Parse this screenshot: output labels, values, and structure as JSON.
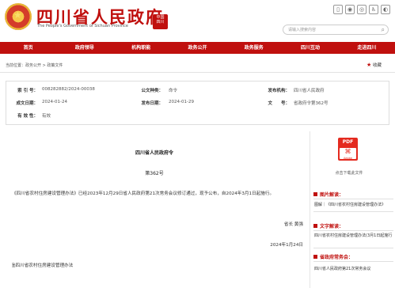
{
  "header": {
    "site_title": "四川省人民政府",
    "site_subtitle": "The People's Government of Sichuan Province",
    "search_placeholder": "请输入搜索内容",
    "top_icons": [
      "mobile-icon",
      "weibo-icon",
      "wechat-icon",
      "accessibility-icon",
      "elder-mode-icon"
    ]
  },
  "nav": {
    "items": [
      "首页",
      "政府领导",
      "机构职能",
      "政务公开",
      "政务服务",
      "四川互动",
      "走进四川"
    ]
  },
  "breadcrumb": {
    "label": "当前位置：",
    "path": [
      "政务公开",
      "政策文件"
    ],
    "separator": " > "
  },
  "favorite": {
    "label": "收藏"
  },
  "info": {
    "index_label": "索 引 号：",
    "index_value": "008282882/2024-00038",
    "category_label": "公文种类：",
    "category_value": "命令",
    "issuer_label": "发布机构：",
    "issuer_value": "四川省人民政府",
    "created_label": "成文日期：",
    "created_value": "2024-01-24",
    "published_label": "发布日期：",
    "published_value": "2024-01-29",
    "docno_label": "文　　号：",
    "docno_value": "省政府令第362号",
    "validity_label": "有 效 性：",
    "validity_value": "有效"
  },
  "article": {
    "title": "四川省人民政府令",
    "number": "第362号",
    "body": "《四川省农村住房建设管理办法》已经2023年12月29日省人民政府第21次常务会议修订通过，现予公布，自2024年3月1日起施行。",
    "signer": "省长  黄强",
    "date": "2024年1月24日",
    "attachment": "四川省农村住房建设管理办法"
  },
  "sidebar": {
    "pdf_label": "点击下载此文件",
    "pdf_badge": "PDF",
    "pdf_brand": "Adobe",
    "sections": [
      {
        "title": "图片解读：",
        "links": [
          "图解｜《四川省农村住房建设管理办法》"
        ]
      },
      {
        "title": "文字解读：",
        "links": [
          "四川省农村住房建设管理办法(3月1日起施行"
        ]
      },
      {
        "title": "省政府常务会：",
        "links": [
          "四川省人民政府第21次常务会议"
        ]
      }
    ]
  },
  "colors": {
    "brand_red": "#c0100e",
    "pdf_red": "#e42a1f"
  }
}
